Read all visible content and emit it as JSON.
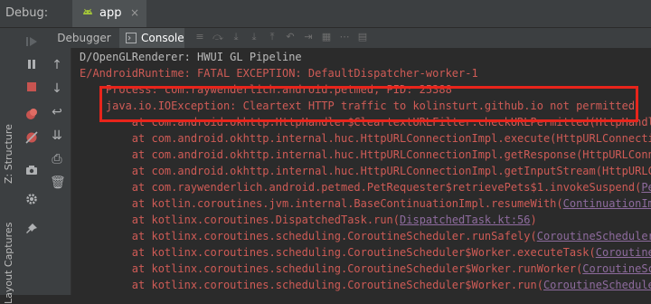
{
  "window": {
    "debug_label": "Debug:",
    "app_tab": "app",
    "close_glyph": "×"
  },
  "tabs": {
    "debugger": "Debugger",
    "console": "Console"
  },
  "left_strip": {
    "structure": "Z: Structure",
    "captures": "Layout Captures"
  },
  "toolbar_icons": [
    "rerun-icon",
    "pause-icon",
    "stop-icon",
    "breakpoints-icon",
    "mute-breakpoints-icon",
    "camera-icon",
    "settings-icon",
    "pin-icon"
  ],
  "console_tool_icons": [
    "up-arrow-icon",
    "down-arrow-icon",
    "soft-wrap-icon",
    "scroll-to-end-icon",
    "print-icon",
    "trash-icon"
  ],
  "console": {
    "lines": [
      {
        "text": "D/OpenGLRenderer: HWUI GL Pipeline",
        "style": "plain"
      },
      {
        "text": "E/AndroidRuntime: FATAL EXCEPTION: DefaultDispatcher-worker-1",
        "style": "error"
      },
      {
        "text": "    Process: com.raywenderlich.android.petmed, PID: 25388",
        "style": "error"
      },
      {
        "text": "    java.io.IOException: Cleartext HTTP traffic to kolinsturt.github.io not permitted",
        "style": "error"
      },
      {
        "text": "        at com.android.okhttp.HttpHandler$CleartextURLFilter.checkURLPermitted(HttpHandler",
        "style": "error"
      },
      {
        "text": "        at com.android.okhttp.internal.huc.HttpURLConnectionImpl.execute(HttpURLConnection",
        "style": "error"
      },
      {
        "text": "        at com.android.okhttp.internal.huc.HttpURLConnectionImpl.getResponse(HttpURLConnect",
        "style": "error"
      },
      {
        "text": "        at com.android.okhttp.internal.huc.HttpURLConnectionImpl.getInputStream(HttpURLConn",
        "style": "error"
      },
      {
        "text": "        at com.raywenderlich.android.petmed.PetRequester$retrievePets$1.invokeSuspend(",
        "style": "error",
        "link": "PetR"
      },
      {
        "text": "        at kotlin.coroutines.jvm.internal.BaseContinuationImpl.resumeWith(",
        "style": "error",
        "link": "ContinuationImpl"
      },
      {
        "text": "        at kotlinx.coroutines.DispatchedTask.run(",
        "style": "error",
        "link": "DispatchedTask.kt:56",
        "suffix": ")"
      },
      {
        "text": "        at kotlinx.coroutines.scheduling.CoroutineScheduler.runSafely(",
        "style": "error",
        "link": "CoroutineScheduler.k"
      },
      {
        "text": "        at kotlinx.coroutines.scheduling.CoroutineScheduler$Worker.executeTask(",
        "style": "error",
        "link": "CoroutineSche"
      },
      {
        "text": "        at kotlinx.coroutines.scheduling.CoroutineScheduler$Worker.runWorker(",
        "style": "error",
        "link": "CoroutineSched"
      },
      {
        "text": "        at kotlinx.coroutines.scheduling.CoroutineScheduler$Worker.run(",
        "style": "error",
        "link": "CoroutineScheduler"
      }
    ]
  },
  "colors": {
    "error_text": "#cf5b56",
    "plain_text": "#bbbbbb",
    "link_text": "#8e6b9e",
    "highlight_border": "#e8241b",
    "android_green": "#a4c639"
  }
}
